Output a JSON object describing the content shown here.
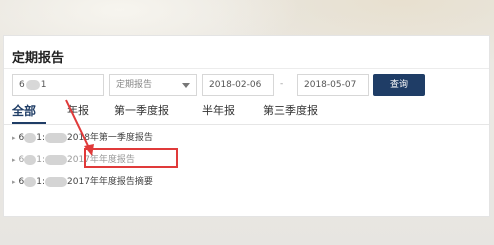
{
  "page": {
    "title": "定期报告"
  },
  "filters": {
    "code_value": "6",
    "code_suffix": "1",
    "report_type_placeholder": "定期报告",
    "date_from": "2018-02-06",
    "date_separator": "-",
    "date_to": "2018-05-07",
    "query_label": "查询"
  },
  "tabs": [
    {
      "label": "全部",
      "active": true
    },
    {
      "label": "年报"
    },
    {
      "label": "第一季度报"
    },
    {
      "label": "半年报"
    },
    {
      "label": "第三季度报"
    }
  ],
  "reports": [
    {
      "prefix": "6",
      "mid": "1:",
      "title": "2018年第一季度报告"
    },
    {
      "prefix": "6",
      "mid": "1:",
      "title": "2017年年度报告"
    },
    {
      "prefix": "6",
      "mid": "1:",
      "title": "2017年年度报告摘要"
    }
  ],
  "annotation": {
    "color": "#e03a3a"
  }
}
